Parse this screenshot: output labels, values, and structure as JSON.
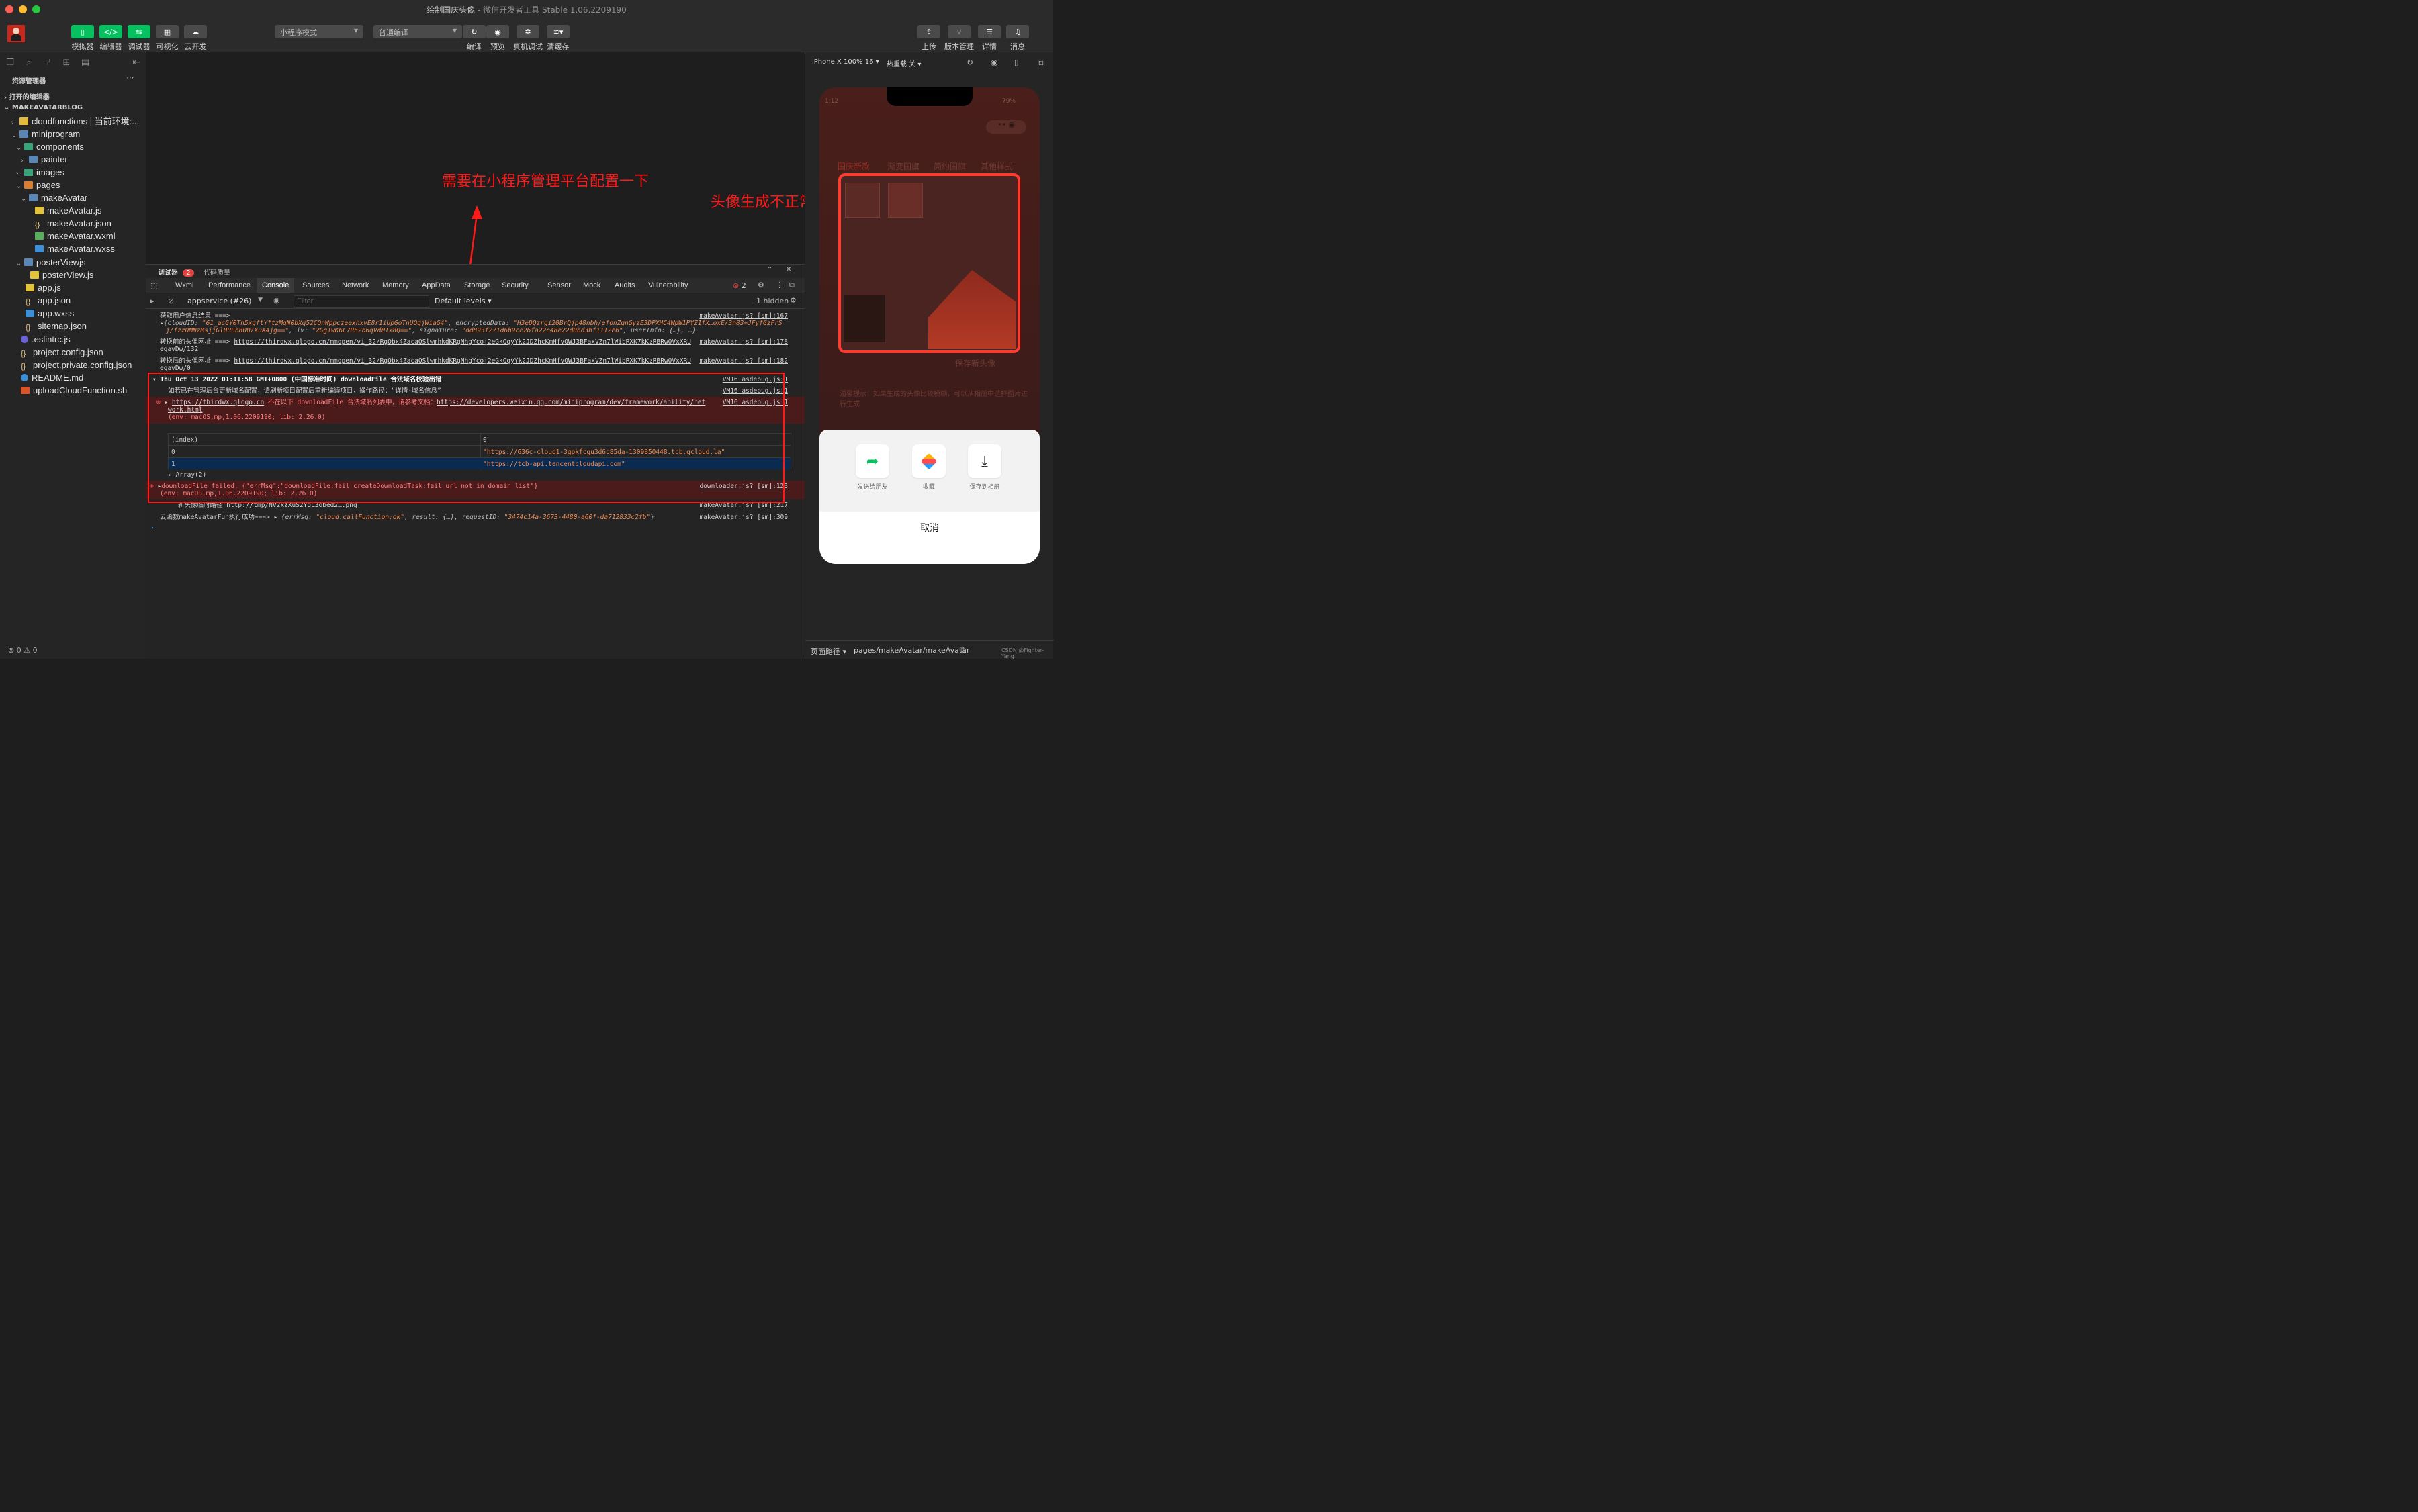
{
  "window": {
    "title": "绘制国庆头像",
    "subtitle": " - 微信开发者工具 Stable 1.06.2209190"
  },
  "toolbar": {
    "left_buttons": [
      "模拟器",
      "编辑器",
      "调试器",
      "可视化",
      "云开发"
    ],
    "mode_select": "小程序模式",
    "compile_select": "普通编译",
    "mid_buttons": [
      "编译",
      "预览",
      "真机调试",
      "清缓存"
    ],
    "right_buttons": [
      "上传",
      "版本管理",
      "详情",
      "消息"
    ]
  },
  "explorer": {
    "title": "资源管理器",
    "more": "···",
    "open_editors": "打开的编辑器",
    "project": "MAKEAVATARBLOG",
    "items": [
      "cloudfunctions | 当前环境:...",
      "miniprogram",
      "components",
      "painter",
      "images",
      "pages",
      "makeAvatar",
      "makeAvatar.js",
      "makeAvatar.json",
      "makeAvatar.wxml",
      "makeAvatar.wxss",
      "posterViewjs",
      "posterView.js",
      "app.js",
      "app.json",
      "app.wxss",
      "sitemap.json",
      ".eslintrc.js",
      "project.config.json",
      "project.private.config.json",
      "README.md",
      "uploadCloudFunction.sh"
    ],
    "status": "⊗ 0 ⚠ 0"
  },
  "annotations": {
    "note1": "需要在小程序管理平台配置一下",
    "note2": "头像生成不正常"
  },
  "devtools": {
    "top_tabs": [
      "调试器",
      "代码质量"
    ],
    "error_badge": "2",
    "tabs": [
      "Wxml",
      "Performance",
      "Console",
      "Sources",
      "Network",
      "Memory",
      "AppData",
      "Storage",
      "Security",
      "Sensor",
      "Mock",
      "Audits",
      "Vulnerability"
    ],
    "active_tab": "Console",
    "error_count": "2",
    "context": "appservice (#26)",
    "filter_placeholder": "Filter",
    "levels": "Default levels",
    "hidden": "1 hidden",
    "lines": {
      "l1": "获取用户信息结果 ===>",
      "l1_src": "makeAvatar.js? [sm]:167",
      "l2a": "{cloudID: ",
      "l2b": "\"61_acGY0Tn5xgftYftzMqN0bXq52COnWppczeexhxvE8r1iUpGoTnUOqjWiaG4\"",
      "l2c": ", encryptedData: ",
      "l2d": "\"H3eDQzrgi20BrQjp48nbh/efonZgnGyzE3DPXHC4WpW1PYZ1fX…oxE/3n83+JFyfGzFrS",
      "l3a": "j/fzzDMNzMsjjGl0RSb800/XuA4jg==\"",
      "l3b": ", iv: ",
      "l3c": "\"2Gg1wK6L7RE2o6qVdM1x8Q==\"",
      "l3d": ", signature: ",
      "l3e": "\"dd893f271d6b9ce26fa22c48e22d0bd3bf1112e6\"",
      "l3f": ", userInfo: {…}, …}",
      "l4": "转换前的头像网址 ===> ",
      "l4_url": "https://thirdwx.qlogo.cn/mmopen/vi_32/RgObx4ZacaQSlwmhkdKRgNhgYcoj2eGkQqyYk2JDZhcKmHfvQWJ3BFaxVZn7lWibRXK7kKzRBRw0VxXRU",
      "l4_url2": "egavDw/132",
      "l4_src": "makeAvatar.js? [sm]:178",
      "l5": "转换后的头像网址 ===> ",
      "l5_url": "https://thirdwx.qlogo.cn/mmopen/vi_32/RgObx4ZacaQSlwmhkdKRgNhgYcoj2eGkQqyYk2JDZhcKmHfvQWJ3BFaxVZn7lWibRXK7kKzRBRw0VxXRU",
      "l5_url2": "egavDw/0",
      "l5_src": "makeAvatar.js? [sm]:182",
      "g_head": "Thu Oct 13 2022 01:11:58 GMT+0800 (中国标准时间) downloadFile 合法域名校验出错",
      "g_src": "VM16 asdebug.js:1",
      "g1": "如若已在管理后台更新域名配置，请刷新项目配置后重新编译项目，操作路径：“详情-域名信息”",
      "e1_url": "https://thirdwx.qlogo.cn",
      "e1_mid": " 不在以下 downloadFile 合法域名列表中，请参考文档：",
      "e1_doc": "https://developers.weixin.qq.com/miniprogram/dev/framework/ability/net",
      "e1_doc2": "work.html",
      "e1_env": "(env: macOS,mp,1.06.2209190; lib: 2.26.0)",
      "table_h1": "(index)",
      "table_h2": "0",
      "row0_i": "0",
      "row0_v": "\"https://636c-cloud1-3gpkfcgu3d6c85da-1309850448.tcb.qcloud.la\"",
      "row1_i": "1",
      "row1_v": "\"https://tcb-api.tencentcloudapi.com\"",
      "array": "Array(2)",
      "e2": "downloadFile failed, {\"errMsg\":\"downloadFile:fail createDownloadTask:fail url not in domain list\"}",
      "e2_env": "(env: macOS,mp,1.06.2209190; lib: 2.26.0)",
      "e2_src": "downloader.js? [sm]:123",
      "l6": "新头像临时路径 ",
      "l6_url": "http://tmp/NV2kzXuS2YgL3obed2….png",
      "l6_src": "makeAvatar.js? [sm]:217",
      "l7a": "云函数makeAvatarFun执行成功===> ",
      "l7b": "{errMsg: ",
      "l7c": "\"cloud.callFunction:ok\"",
      "l7d": ", result: {…}, requestID: ",
      "l7e": "\"3474c14a-3673-4480-a60f-da712833c2fb\"",
      "l7f": "}",
      "l7_src": "makeAvatar.js? [sm]:309"
    }
  },
  "simulator": {
    "device": "iPhone X 100% 16 ▾",
    "hotreload": "热重载 关 ▾",
    "status_time": "1:12",
    "battery": "79%",
    "tabs": [
      "国庆新款",
      "渐变国旗",
      "简约国旗",
      "其他样式"
    ],
    "save_btn": "保存新头像",
    "hint": "温馨提示：如果生成的头像比较模糊，可以从相册中选择图片进行生成",
    "sheet": {
      "share": "发送给朋友",
      "collect": "收藏",
      "save": "保存到相册",
      "cancel": "取消"
    },
    "footer_path_label": "页面路径 ▾",
    "footer_path": "pages/makeAvatar/makeAvatar",
    "watermark": "CSDN @Fighter-Yang"
  },
  "colors": {
    "accent_green": "#07c160",
    "annotation_red": "#ff1a1a",
    "error_bg": "#4b1a1a"
  }
}
